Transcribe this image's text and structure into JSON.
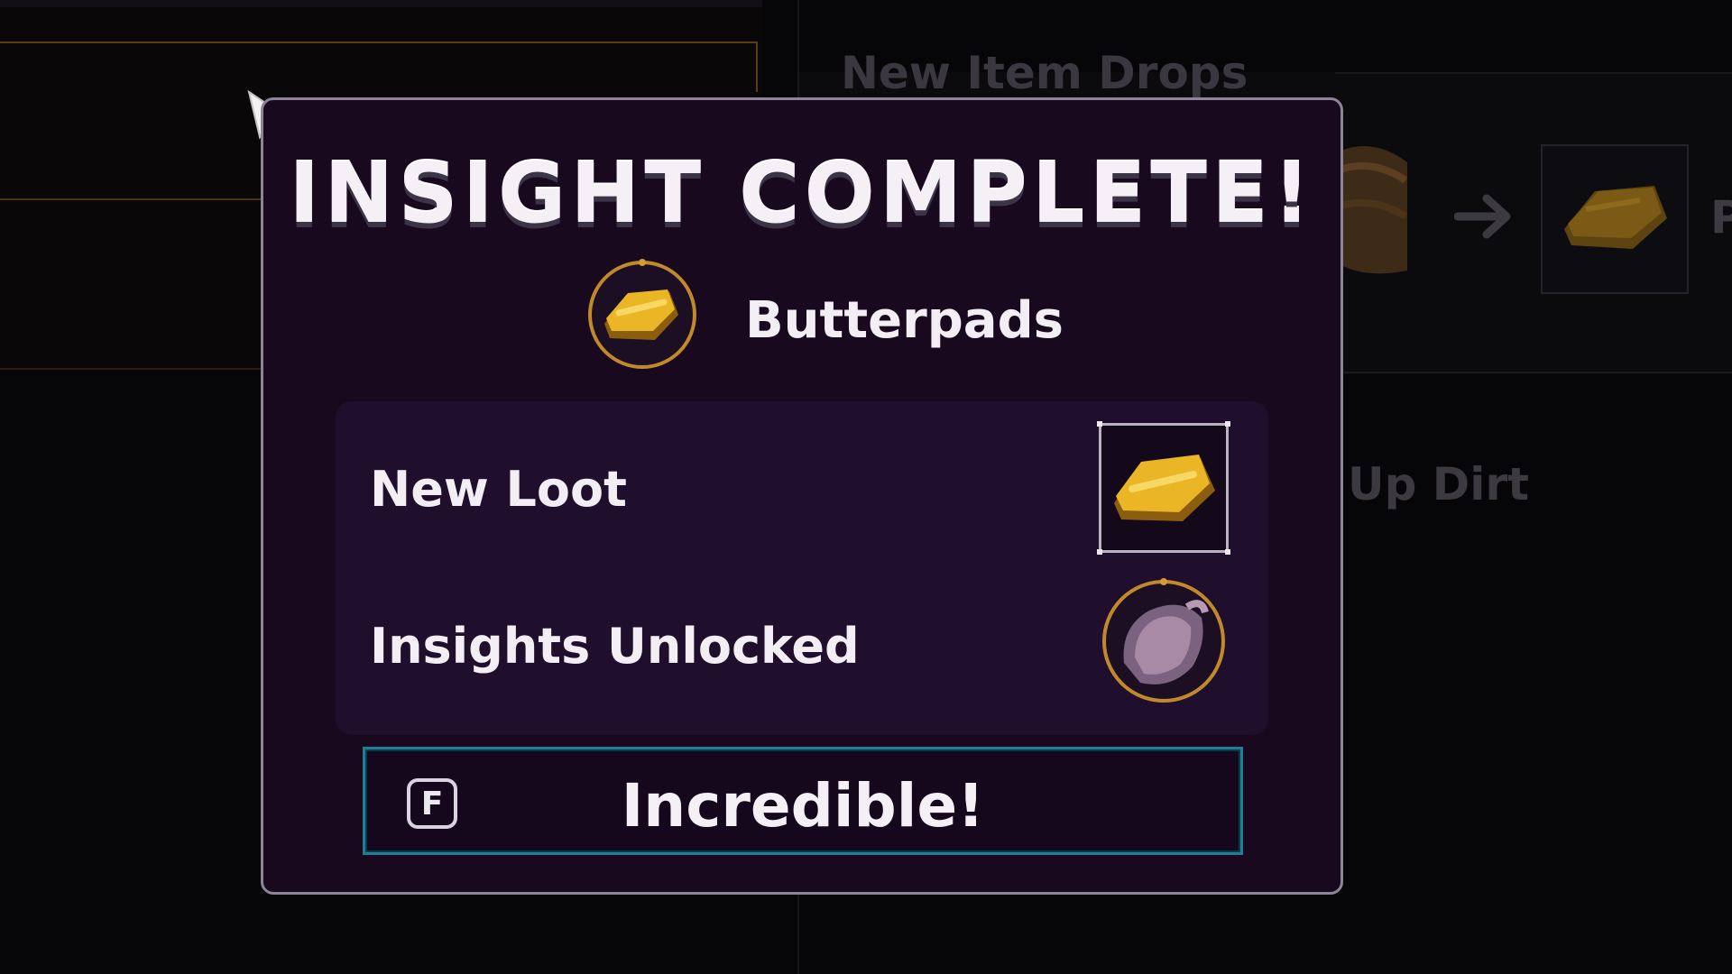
{
  "background": {
    "heading": "New Item Drops",
    "cut_letter": "P",
    "partial_text": "Up Dirt",
    "arrow_icon": "right-arrow-icon"
  },
  "modal": {
    "title": "Insight Complete!",
    "insight": {
      "name": "Butterpads",
      "icon": "butterpad-icon"
    },
    "rewards": {
      "new_loot_label": "New Loot",
      "new_loot_icon": "butterpad-icon",
      "insights_unlocked_label": "Insights Unlocked",
      "insights_unlocked_icon": "meat-chunk-icon"
    },
    "confirm": {
      "key": "F",
      "label": "Incredible!"
    }
  },
  "colors": {
    "modal_bg": "#18091f",
    "rewards_bg": "#1f0e2c",
    "button_border": "#1f7f96",
    "gold_ring": "#c08a2a",
    "butterpad_gold": "#e8b41c"
  }
}
